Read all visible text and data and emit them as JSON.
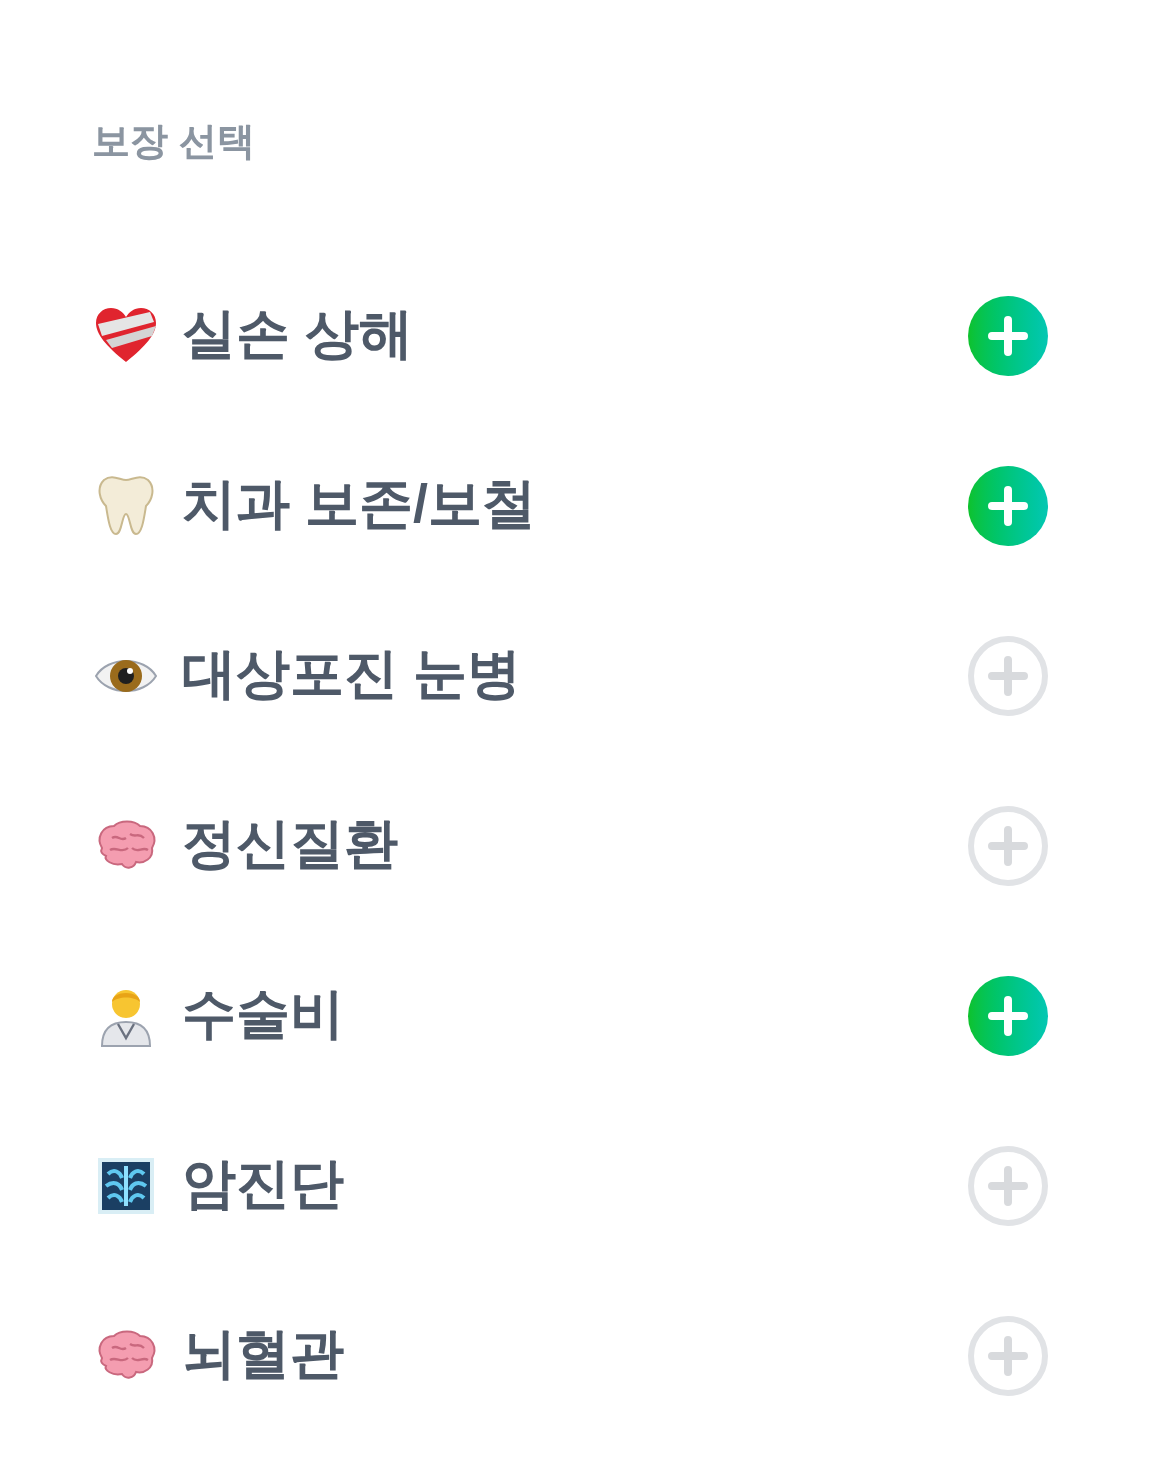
{
  "heading": "보장 선택",
  "coverages": [
    {
      "label": "실손 상해",
      "selected": true
    },
    {
      "label": "치과 보존/보철",
      "selected": true
    },
    {
      "label": "대상포진 눈병",
      "selected": false
    },
    {
      "label": "정신질환",
      "selected": false
    },
    {
      "label": "수술비",
      "selected": true
    },
    {
      "label": "암진단",
      "selected": false
    },
    {
      "label": "뇌혈관",
      "selected": false
    }
  ]
}
